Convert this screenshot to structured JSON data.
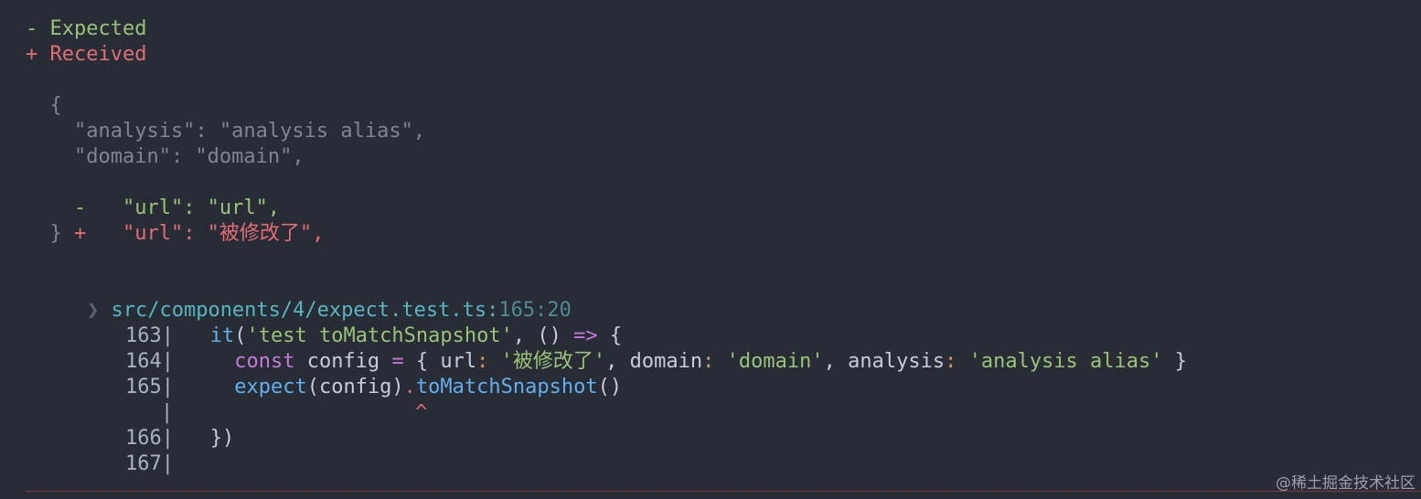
{
  "legend": {
    "expected": "- Expected",
    "received": "+ Received"
  },
  "diff": {
    "open_brace": "  {",
    "line_analysis": "    \"analysis\": \"analysis alias\",",
    "line_domain": "    \"domain\": \"domain\",",
    "minus_marker": "-",
    "minus_text": "   \"url\": \"url\",",
    "plus_marker": "+",
    "plus_text": "   \"url\": \"被修改了\",",
    "close_brace": "  }"
  },
  "location": {
    "chevron": "❯",
    "path": "src/components/4/expect.test.ts",
    "sep": ":",
    "position": "165:20"
  },
  "code": [
    {
      "num": "163",
      "sep": "|"
    },
    {
      "num": "164",
      "sep": "|"
    },
    {
      "num": "165",
      "sep": "|"
    },
    {
      "num": "",
      "sep": "|"
    },
    {
      "num": "166",
      "sep": "|"
    },
    {
      "num": "167",
      "sep": "|"
    }
  ],
  "tokens": {
    "l163_it": "it",
    "l163_paren": "(",
    "l163_str": "'test toMatchSnapshot'",
    "l163_rest1": ", () ",
    "l163_arrow": "=>",
    "l163_rest2": " {",
    "l164_const": "const",
    "l164_config": " config ",
    "l164_eq": "=",
    "l164_ob": " { ",
    "l164_url": "url",
    "l164_c1": ": ",
    "l164_s1": "'被修改了'",
    "l164_comma1": ", ",
    "l164_domain": "domain",
    "l164_c2": ": ",
    "l164_s2": "'domain'",
    "l164_comma2": ", ",
    "l164_analysis": "analysis",
    "l164_c3": ": ",
    "l164_s3": "'analysis alias'",
    "l164_cb": " }",
    "l165_expect": "expect",
    "l165_args": "(config)",
    "l165_dot": ".",
    "l165_method": "toMatchSnapshot",
    "l165_call": "()",
    "caret": "^",
    "l166_close": "})"
  },
  "watermark": "@稀土掘金技术社区",
  "colors": {
    "background": "#282c34",
    "expected": "#98c379",
    "received": "#e06c75"
  }
}
